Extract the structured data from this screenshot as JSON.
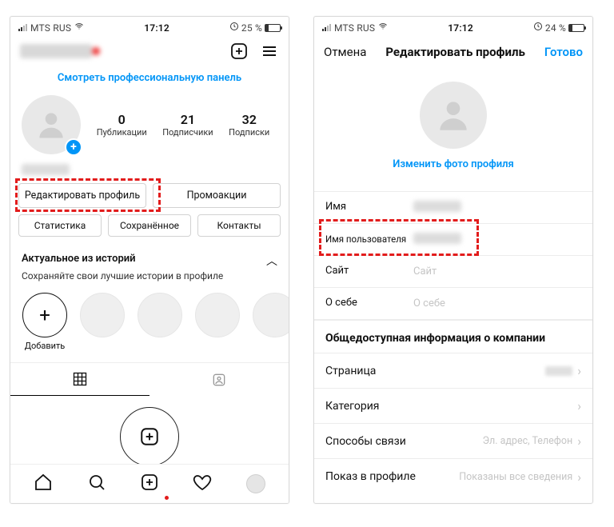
{
  "left": {
    "status": {
      "carrier": "MTS RUS",
      "time": "17:12",
      "battery": "25 %"
    },
    "pro_panel": "Смотреть профессиональную панель",
    "stats": {
      "posts": {
        "num": "0",
        "label": "Публикации"
      },
      "followers": {
        "num": "21",
        "label": "Подписчики"
      },
      "following": {
        "num": "32",
        "label": "Подписки"
      }
    },
    "buttons": {
      "edit": "Редактировать профиль",
      "promo": "Промоакции",
      "stats": "Статистика",
      "saved": "Сохранённое",
      "contacts": "Контакты"
    },
    "stories": {
      "title": "Актуальное из историй",
      "sub": "Сохраняйте свои лучшие истории в профиле",
      "add": "Добавить"
    }
  },
  "right": {
    "status": {
      "carrier": "MTS RUS",
      "time": "17:12",
      "battery": "24 %"
    },
    "header": {
      "cancel": "Отмена",
      "title": "Редактировать профиль",
      "done": "Готово"
    },
    "change_photo": "Изменить фото профиля",
    "fields": {
      "name": "Имя",
      "username": "Имя пользователя",
      "site_lbl": "Сайт",
      "site_ph": "Сайт",
      "bio_lbl": "О себе",
      "bio_ph": "О себе"
    },
    "biz": {
      "title": "Общедоступная информация о компании",
      "page": "Страница",
      "category": "Категория",
      "contact": "Способы связи",
      "contact_value": "Эл. адрес, Телефон",
      "display": "Показ в профиле",
      "display_value": "Показаны все сведения"
    }
  }
}
